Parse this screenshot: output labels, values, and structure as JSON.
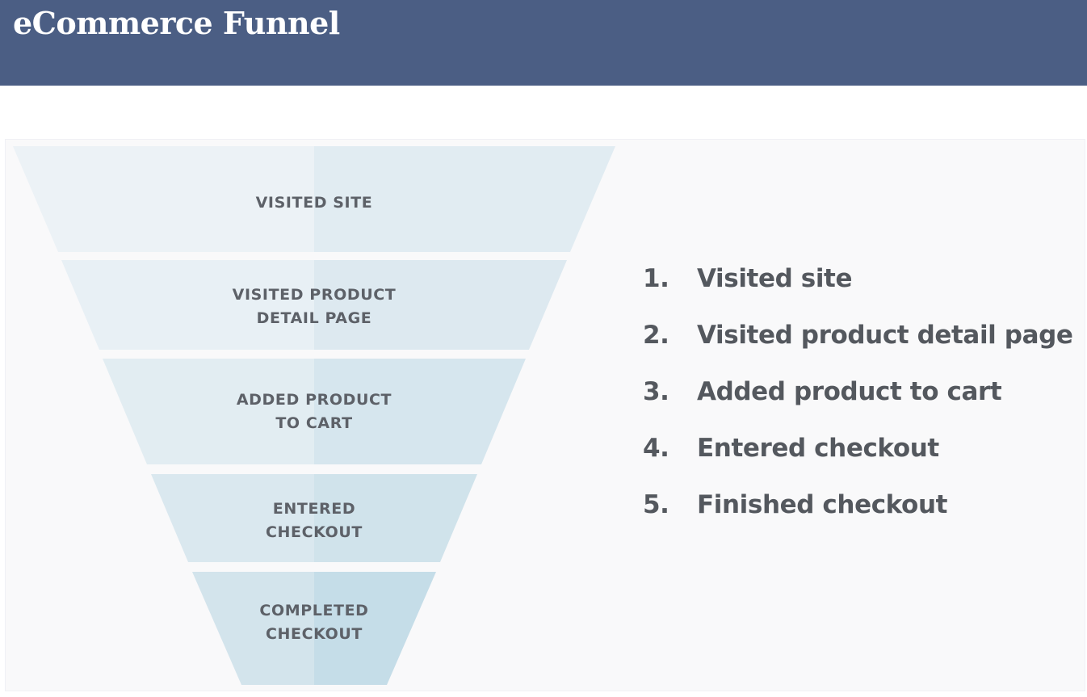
{
  "header": {
    "title": "eCommerce Funnel",
    "background_color": "#4b5e84"
  },
  "funnel": {
    "stages": [
      {
        "line1": "VISITED SITE",
        "line2": ""
      },
      {
        "line1": "VISITED PRODUCT",
        "line2": "DETAIL PAGE"
      },
      {
        "line1": "ADDED PRODUCT",
        "line2": "TO CART"
      },
      {
        "line1": "ENTERED",
        "line2": "CHECKOUT"
      },
      {
        "line1": "COMPLETED",
        "line2": "CHECKOUT"
      }
    ],
    "colors": [
      {
        "left": "#ecf2f6",
        "right": "#e1ecf2"
      },
      {
        "left": "#e8f0f5",
        "right": "#dde9f0"
      },
      {
        "left": "#e2edf2",
        "right": "#d6e6ee"
      },
      {
        "left": "#dae8ef",
        "right": "#d0e3eb"
      },
      {
        "left": "#d3e4ec",
        "right": "#c5dde8"
      }
    ]
  },
  "steps": {
    "items": [
      {
        "number": "1.",
        "label": "Visited site"
      },
      {
        "number": "2.",
        "label": "Visited product detail page"
      },
      {
        "number": "3.",
        "label": "Added product to cart"
      },
      {
        "number": "4.",
        "label": "Entered checkout"
      },
      {
        "number": "5.",
        "label": "Finished checkout"
      }
    ]
  }
}
